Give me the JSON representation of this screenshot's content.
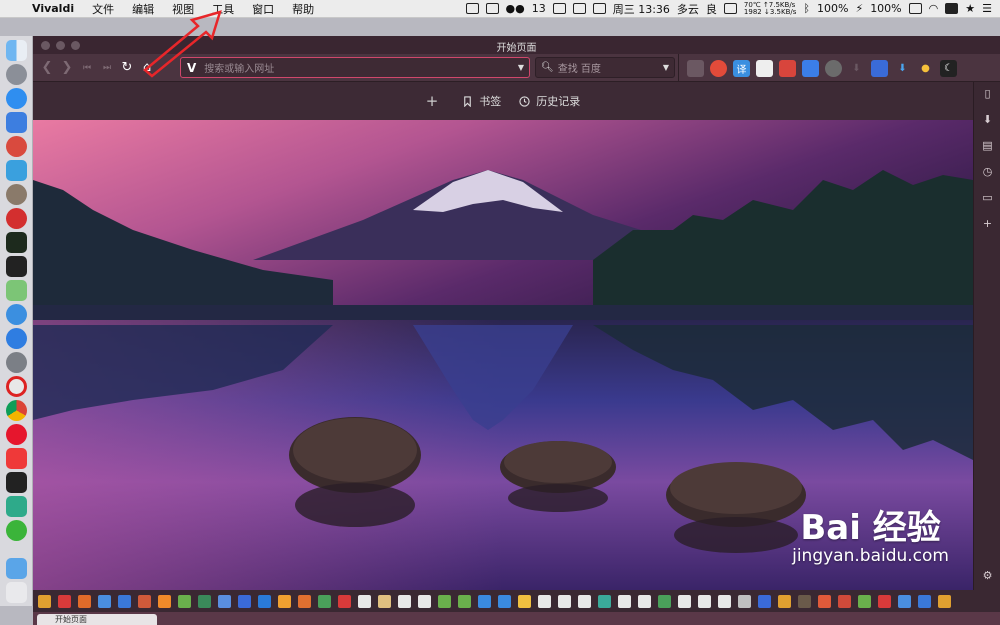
{
  "menubar": {
    "app_name": "Vivaldi",
    "items": [
      "文件",
      "编辑",
      "视图",
      "工具",
      "窗口",
      "帮助"
    ],
    "wechat_count": "13",
    "datetime": "周三 13:36",
    "weather": "多云",
    "air": "良",
    "cpu_temp": "70℃",
    "fan": "1982",
    "net_up": "↑7.5KB/s",
    "net_down": "↓3.5KB/s",
    "battery1": "100%",
    "battery2": "100%"
  },
  "window": {
    "title": "开始页面"
  },
  "toolbar": {
    "address_placeholder": "搜索或输入网址",
    "search_placeholder": "查找 百度",
    "vivaldi_glyph": "V"
  },
  "speeddial_bar": {
    "add": "+",
    "bookmarks": "书签",
    "history": "历史记录"
  },
  "bottom_tab": {
    "label": "开始页面"
  },
  "watermark": {
    "logo": "Bai 经验",
    "url": "jingyan.baidu.com"
  },
  "colors": {
    "accent": "#d0476b",
    "toolbar": "#4b3440",
    "window_bg": "#3d2a35"
  }
}
